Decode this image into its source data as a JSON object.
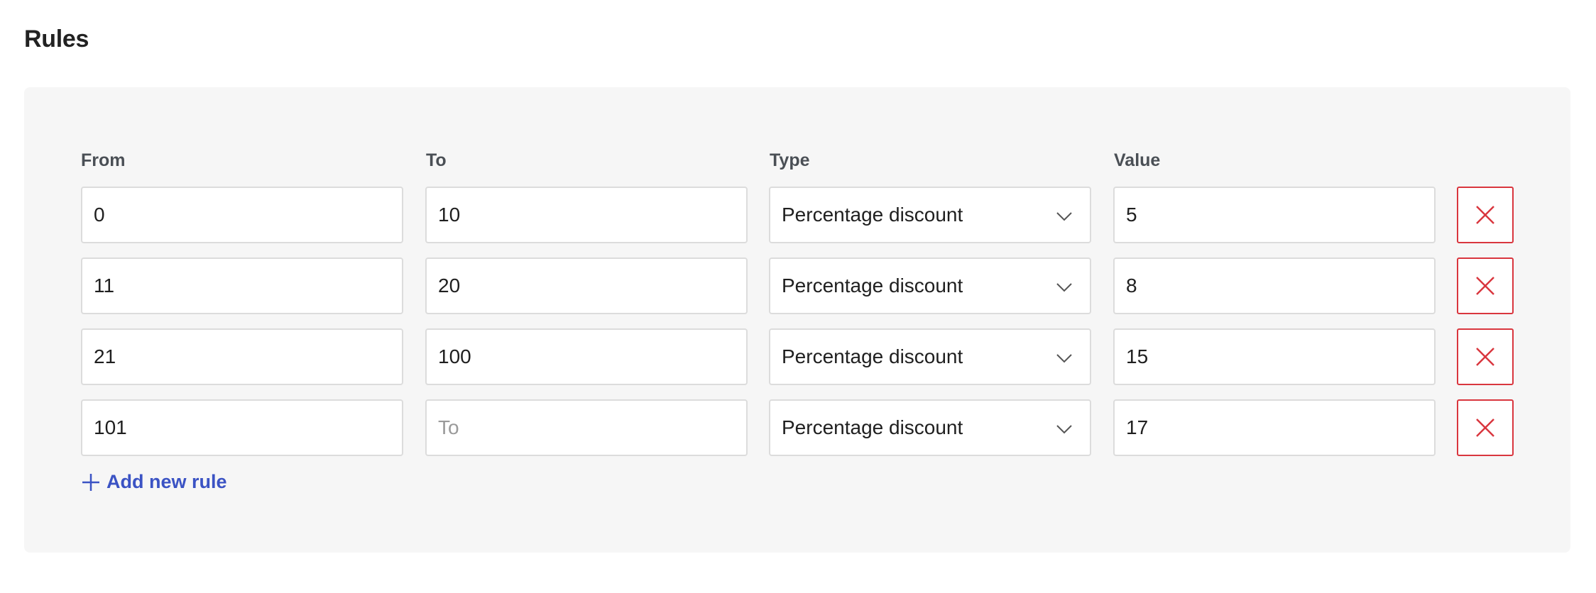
{
  "title": "Rules",
  "headers": {
    "from": "From",
    "to": "To",
    "type": "Type",
    "value": "Value"
  },
  "rules": [
    {
      "from": "0",
      "to": "10",
      "type": "Percentage discount",
      "value": "5"
    },
    {
      "from": "11",
      "to": "20",
      "type": "Percentage discount",
      "value": "8"
    },
    {
      "from": "21",
      "to": "100",
      "type": "Percentage discount",
      "value": "15"
    },
    {
      "from": "101",
      "to": "",
      "type": "Percentage discount",
      "value": "17"
    }
  ],
  "placeholders": {
    "from": "From",
    "to": "To",
    "value": "Value"
  },
  "add_rule_label": "Add new rule",
  "icons": {
    "remove": "close-icon",
    "select": "chevron-down-icon",
    "add": "plus-icon"
  },
  "colors": {
    "accent": "#3b53c4",
    "danger": "#d9363e",
    "panel_bg": "#f6f6f6"
  }
}
